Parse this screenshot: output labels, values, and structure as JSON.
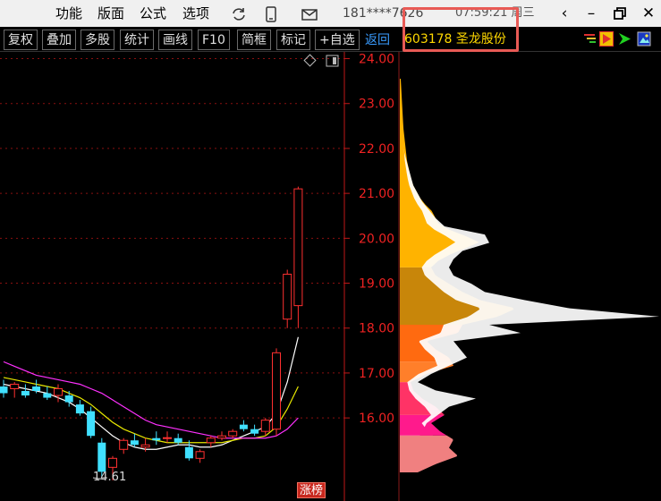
{
  "menu": {
    "items": [
      "功能",
      "版面",
      "公式",
      "选项"
    ],
    "account": "181****7626",
    "clock": "07:59:21 周三"
  },
  "toolbar": {
    "buttons": [
      "复权",
      "叠加",
      "多股",
      "统计",
      "画线",
      "F10",
      "简框",
      "标记",
      "+自选"
    ],
    "back": "返回"
  },
  "stock": {
    "code": "603178",
    "name": "圣龙股份",
    "title": "603178 圣龙股份"
  },
  "chart_data": {
    "type": "candlestick",
    "y_ticks": [
      16.0,
      17.0,
      18.0,
      19.0,
      20.0,
      21.0,
      22.0,
      23.0,
      24.0
    ],
    "y_tick_labels": [
      "16.00",
      "17.00",
      "18.00",
      "19.00",
      "20.00",
      "21.00",
      "22.00",
      "23.00",
      "24.00"
    ],
    "ylim": [
      14.15,
      24.15
    ],
    "low_marker": "14.61",
    "limit_badge": "涨榜",
    "candles": [
      {
        "o": 16.7,
        "h": 16.85,
        "l": 16.45,
        "c": 16.55
      },
      {
        "o": 16.65,
        "h": 16.8,
        "l": 16.45,
        "c": 16.75
      },
      {
        "o": 16.6,
        "h": 16.75,
        "l": 16.45,
        "c": 16.5
      },
      {
        "o": 16.7,
        "h": 16.85,
        "l": 16.55,
        "c": 16.6
      },
      {
        "o": 16.55,
        "h": 16.7,
        "l": 16.4,
        "c": 16.45
      },
      {
        "o": 16.5,
        "h": 16.75,
        "l": 16.35,
        "c": 16.65
      },
      {
        "o": 16.5,
        "h": 16.6,
        "l": 16.25,
        "c": 16.35
      },
      {
        "o": 16.3,
        "h": 16.4,
        "l": 16.05,
        "c": 16.1
      },
      {
        "o": 16.15,
        "h": 16.25,
        "l": 15.55,
        "c": 15.6
      },
      {
        "o": 15.45,
        "h": 15.55,
        "l": 14.7,
        "c": 14.8
      },
      {
        "o": 14.9,
        "h": 15.15,
        "l": 14.61,
        "c": 15.1
      },
      {
        "o": 15.3,
        "h": 15.55,
        "l": 15.2,
        "c": 15.5
      },
      {
        "o": 15.5,
        "h": 15.65,
        "l": 15.35,
        "c": 15.4
      },
      {
        "o": 15.35,
        "h": 15.55,
        "l": 15.25,
        "c": 15.4
      },
      {
        "o": 15.55,
        "h": 15.7,
        "l": 15.4,
        "c": 15.5
      },
      {
        "o": 15.55,
        "h": 15.7,
        "l": 15.45,
        "c": 15.56
      },
      {
        "o": 15.55,
        "h": 15.65,
        "l": 15.4,
        "c": 15.45
      },
      {
        "o": 15.35,
        "h": 15.5,
        "l": 15.05,
        "c": 15.1
      },
      {
        "o": 15.1,
        "h": 15.3,
        "l": 15.0,
        "c": 15.25
      },
      {
        "o": 15.45,
        "h": 15.6,
        "l": 15.35,
        "c": 15.55
      },
      {
        "o": 15.55,
        "h": 15.7,
        "l": 15.5,
        "c": 15.6
      },
      {
        "o": 15.6,
        "h": 15.75,
        "l": 15.55,
        "c": 15.7
      },
      {
        "o": 15.85,
        "h": 15.95,
        "l": 15.7,
        "c": 15.75
      },
      {
        "o": 15.75,
        "h": 15.85,
        "l": 15.6,
        "c": 15.65
      },
      {
        "o": 15.7,
        "h": 16.0,
        "l": 15.6,
        "c": 15.95
      },
      {
        "o": 15.75,
        "h": 17.55,
        "l": 15.6,
        "c": 17.45
      },
      {
        "o": 18.2,
        "h": 19.3,
        "l": 18.0,
        "c": 19.2
      },
      {
        "o": 18.5,
        "h": 21.15,
        "l": 18.0,
        "c": 21.1
      }
    ],
    "ma_lines": [
      {
        "color": "#ffffff",
        "values": [
          16.75,
          16.7,
          16.65,
          16.6,
          16.55,
          16.45,
          16.35,
          16.2,
          16.0,
          15.8,
          15.6,
          15.45,
          15.35,
          15.3,
          15.3,
          15.35,
          15.4,
          15.4,
          15.35,
          15.35,
          15.4,
          15.5,
          15.6,
          15.7,
          15.8,
          16.1,
          16.8,
          17.8
        ]
      },
      {
        "color": "#e8e800",
        "values": [
          16.9,
          16.85,
          16.8,
          16.75,
          16.7,
          16.65,
          16.55,
          16.45,
          16.3,
          16.1,
          15.9,
          15.75,
          15.65,
          15.55,
          15.5,
          15.45,
          15.45,
          15.45,
          15.45,
          15.45,
          15.45,
          15.5,
          15.55,
          15.55,
          15.6,
          15.8,
          16.2,
          16.7
        ]
      },
      {
        "color": "#ff30ff",
        "values": [
          17.25,
          17.15,
          17.05,
          16.95,
          16.9,
          16.85,
          16.8,
          16.75,
          16.65,
          16.55,
          16.4,
          16.25,
          16.1,
          15.95,
          15.85,
          15.8,
          15.75,
          15.7,
          15.65,
          15.6,
          15.55,
          15.55,
          15.55,
          15.55,
          15.55,
          15.6,
          15.75,
          16.0
        ]
      }
    ],
    "volume_profile": {
      "price_min": 14.8,
      "price_max": 24.4,
      "bands": [
        {
          "from": 14.8,
          "to": 15.7,
          "color": "#f08080"
        },
        {
          "from": 15.7,
          "to": 16.2,
          "color": "#ff1a8c"
        },
        {
          "from": 16.2,
          "to": 17.0,
          "color": "#ff3366"
        },
        {
          "from": 17.0,
          "to": 17.5,
          "color": "#ff7f2a"
        },
        {
          "from": 17.5,
          "to": 18.4,
          "color": "#ff6a10"
        },
        {
          "from": 18.4,
          "to": 19.8,
          "color": "#c8860a"
        },
        {
          "from": 19.8,
          "to": 24.4,
          "color": "#ffb300"
        }
      ],
      "volume": [
        [
          14.8,
          20
        ],
        [
          15.0,
          40
        ],
        [
          15.2,
          65
        ],
        [
          15.4,
          55
        ],
        [
          15.6,
          60
        ],
        [
          15.8,
          45
        ],
        [
          16.0,
          35
        ],
        [
          16.2,
          50
        ],
        [
          16.4,
          40
        ],
        [
          16.6,
          25
        ],
        [
          16.8,
          15
        ],
        [
          17.0,
          12
        ],
        [
          17.2,
          30
        ],
        [
          17.4,
          60
        ],
        [
          17.6,
          55
        ],
        [
          17.8,
          40
        ],
        [
          18.0,
          30
        ],
        [
          18.2,
          65
        ],
        [
          18.4,
          70
        ],
        [
          18.6,
          110
        ],
        [
          18.8,
          130
        ],
        [
          19.0,
          90
        ],
        [
          19.2,
          70
        ],
        [
          19.4,
          55
        ],
        [
          19.6,
          40
        ],
        [
          19.8,
          35
        ],
        [
          20.0,
          45
        ],
        [
          20.2,
          65
        ],
        [
          20.4,
          90
        ],
        [
          20.6,
          70
        ],
        [
          20.8,
          45
        ],
        [
          21.0,
          40
        ],
        [
          21.2,
          35
        ],
        [
          21.4,
          25
        ],
        [
          21.6,
          20
        ],
        [
          21.8,
          15
        ],
        [
          22.0,
          12
        ],
        [
          22.4,
          8
        ],
        [
          22.8,
          6
        ],
        [
          23.2,
          4
        ],
        [
          23.6,
          3
        ],
        [
          24.0,
          2
        ],
        [
          24.4,
          1
        ]
      ],
      "profit": [
        [
          14.8,
          0
        ],
        [
          15.2,
          5
        ],
        [
          15.6,
          20
        ],
        [
          16.0,
          30
        ],
        [
          16.4,
          55
        ],
        [
          16.6,
          85
        ],
        [
          16.8,
          40
        ],
        [
          17.0,
          20
        ],
        [
          17.2,
          35
        ],
        [
          17.6,
          75
        ],
        [
          18.0,
          60
        ],
        [
          18.2,
          135
        ],
        [
          18.4,
          100
        ],
        [
          18.6,
          290
        ],
        [
          18.8,
          190
        ],
        [
          19.0,
          140
        ],
        [
          19.2,
          95
        ],
        [
          19.4,
          80
        ],
        [
          19.6,
          60
        ],
        [
          19.8,
          55
        ],
        [
          20.0,
          60
        ],
        [
          20.2,
          70
        ],
        [
          20.4,
          100
        ],
        [
          20.6,
          95
        ],
        [
          20.8,
          50
        ],
        [
          21.0,
          40
        ],
        [
          21.4,
          25
        ],
        [
          21.8,
          15
        ],
        [
          22.2,
          10
        ],
        [
          22.6,
          5
        ],
        [
          23.0,
          3
        ],
        [
          23.6,
          1
        ],
        [
          24.4,
          0
        ]
      ]
    }
  }
}
